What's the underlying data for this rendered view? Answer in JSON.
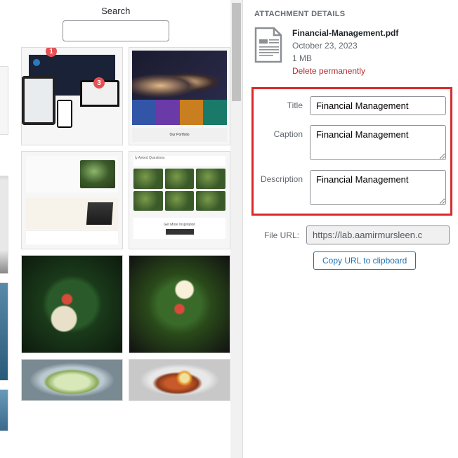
{
  "search": {
    "label": "Search",
    "value": ""
  },
  "details": {
    "heading": "ATTACHMENT DETAILS",
    "file": {
      "name": "Financial-Management.pdf",
      "date": "October 23, 2023",
      "size": "1 MB",
      "delete_label": "Delete permanently"
    },
    "fields": {
      "title_label": "Title",
      "title_value": "Financial Management",
      "caption_label": "Caption",
      "caption_value": "Financial Management",
      "description_label": "Description",
      "description_value": "Financial Management",
      "fileurl_label": "File URL:",
      "fileurl_value": "https://lab.aamirmursleen.c",
      "copy_label": "Copy URL to clipboard"
    }
  },
  "thumbs": {
    "badge1": "1",
    "badge3": "3",
    "portfolio_label": "Our Portfolio",
    "faq_label": "ly Asked Questions",
    "inspiration_label": "Get More Inspiration"
  }
}
